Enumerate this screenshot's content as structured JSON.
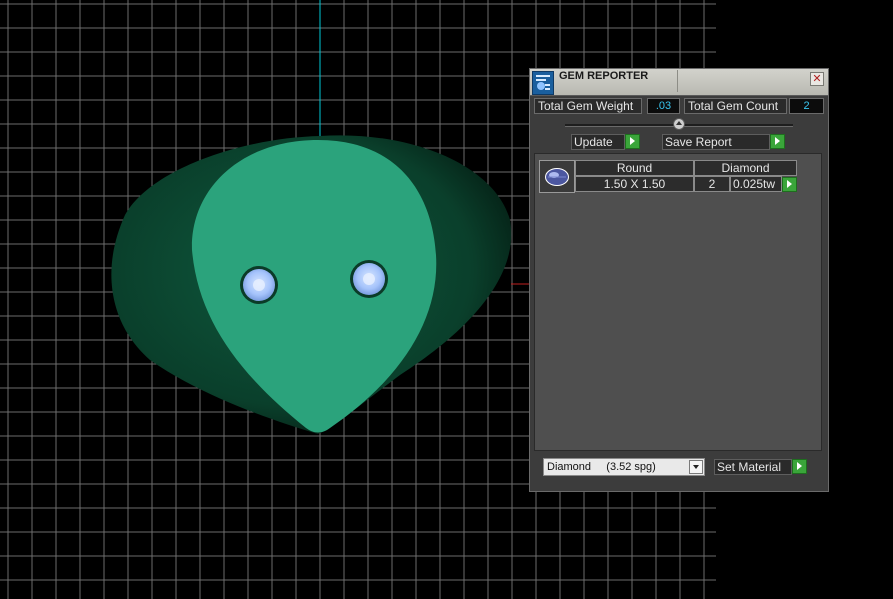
{
  "viewport": {
    "background_color": "#000000",
    "grid_color": "#6d6d6d",
    "axis_color": "#00c8d6",
    "model_colors": {
      "body": "#0d4a33",
      "face": "#2ba37c",
      "stone": "#a8c8ff"
    }
  },
  "panel": {
    "title": "GEM REPORTER",
    "close_icon": "close-icon",
    "total_gem_weight_label": "Total Gem Weight",
    "total_gem_weight_value": ".03",
    "total_gem_count_label": "Total Gem Count",
    "total_gem_count_value": "2",
    "update_label": "Update",
    "save_report_label": "Save Report",
    "gems": [
      {
        "icon": "round-gem-icon",
        "shape": "Round",
        "material": "Diamond",
        "size": "1.50 X 1.50",
        "count": "2",
        "weight": "0.025tw"
      }
    ],
    "material_select_value": "Diamond     (3.52 spg)",
    "set_material_label": "Set Material",
    "accent_color": "#3aa53a"
  }
}
